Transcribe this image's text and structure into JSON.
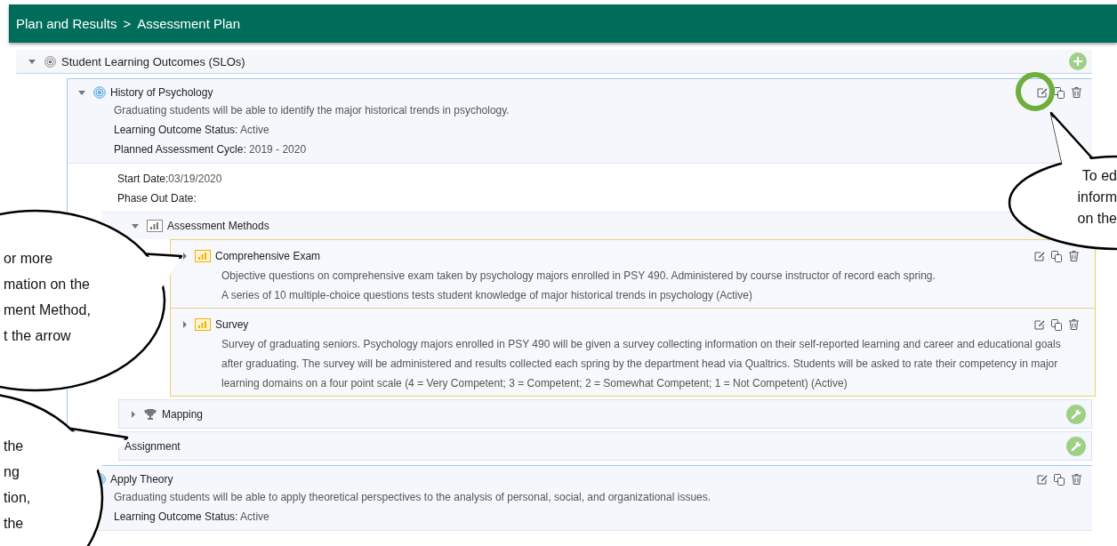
{
  "breadcrumb": {
    "parent": "Plan and Results",
    "separator": ">",
    "current": "Assessment Plan"
  },
  "slo_section": {
    "title": "Student Learning Outcomes (SLOs)",
    "expanded": true
  },
  "outcomes": [
    {
      "title": "History of Psychology",
      "expanded": true,
      "description": "Graduating students will be able to identify the major historical trends in psychology.",
      "fields": [
        {
          "label": "Learning Outcome Status:",
          "value": "Active"
        },
        {
          "label": "Planned Assessment Cycle:",
          "value": "2019 - 2020"
        }
      ],
      "details": [
        {
          "label": "Start Date:",
          "value": "03/19/2020"
        },
        {
          "label": "Phase Out Date:"
        }
      ],
      "methods_section": {
        "title": "Assessment Methods",
        "expanded": true,
        "methods": [
          {
            "title": "Comprehensive Exam",
            "expanded": false,
            "lines": [
              "Objective questions on comprehensive exam taken by psychology majors enrolled in PSY 490. Administered by course instructor of record each spring.",
              "A series of 10 multiple-choice questions tests student knowledge of major historical trends in psychology (Active)"
            ]
          },
          {
            "title": "Survey",
            "expanded": false,
            "lines": [
              "Survey of graduating seniors. Psychology majors enrolled in PSY 490 will be given a survey collecting information on their self-reported learning and career and educational goals after graduating. The survey will be administered and results collected each spring by the department head via Qualtrics. Students will be asked to rate their competency in major learning domains on a four point scale (4 = Very Competent; 3 = Competent; 2 = Somewhat Competent; 1 = Not Competent) (Active)"
            ]
          }
        ]
      },
      "mapping": {
        "title": "Mapping",
        "expanded": false
      },
      "assignment": {
        "title": "Assignment"
      }
    },
    {
      "title": "Apply Theory",
      "description": "Graduating students will be able to apply theoretical perspectives to the analysis of personal, social, and organizational issues.",
      "fields": [
        {
          "label": "Learning Outcome Status:",
          "value": "Active"
        }
      ]
    }
  ],
  "callouts": [
    {
      "kind": "left-top",
      "lines": [
        "or more",
        "mation on the",
        "ment Method,",
        "t the arrow"
      ]
    },
    {
      "kind": "left-bottom",
      "lines": [
        "the",
        "ng",
        "tion,",
        "the"
      ]
    },
    {
      "kind": "right",
      "lines": [
        "To ed",
        "inform",
        "on the"
      ]
    }
  ]
}
